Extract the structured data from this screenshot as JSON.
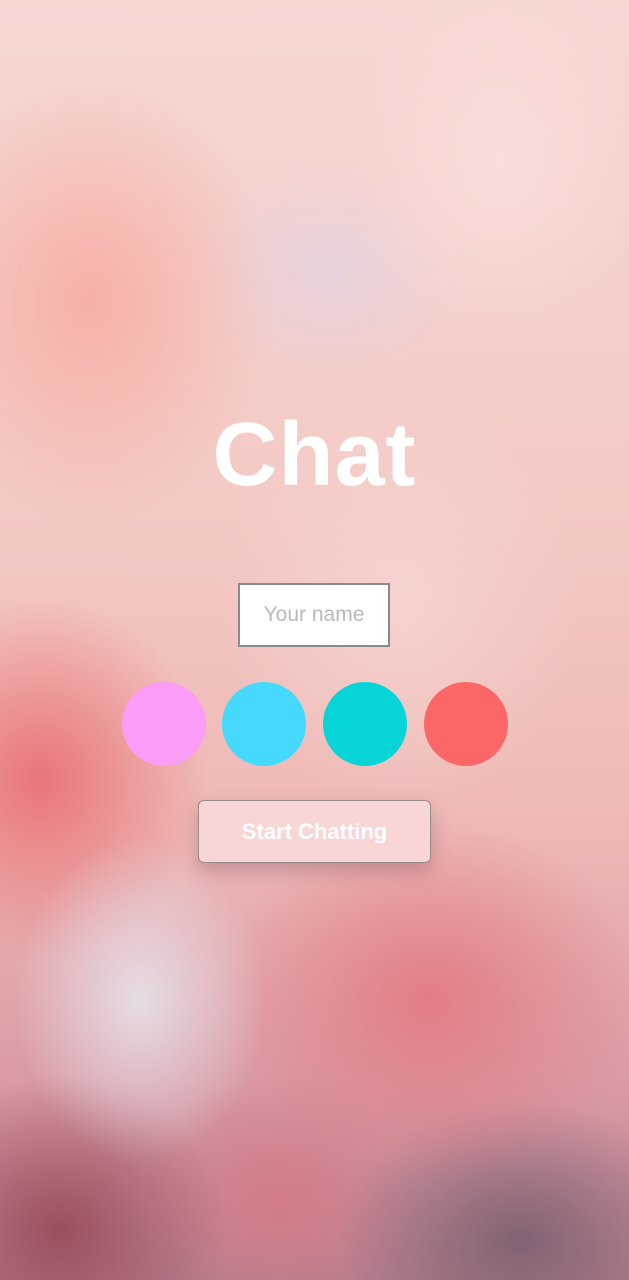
{
  "app": {
    "title": "Chat"
  },
  "form": {
    "name_placeholder": "Your name",
    "name_value": "",
    "color_options": [
      {
        "name": "pink",
        "color": "#fb9cf6"
      },
      {
        "name": "light-blue",
        "color": "#45d9fe"
      },
      {
        "name": "teal",
        "color": "#07d4d6"
      },
      {
        "name": "coral",
        "color": "#fb6767"
      }
    ],
    "start_label": "Start Chatting"
  },
  "theme": {
    "background": "pink clouds photo",
    "button_bg": "#f9d6d6",
    "title_color": "#ffffff"
  }
}
